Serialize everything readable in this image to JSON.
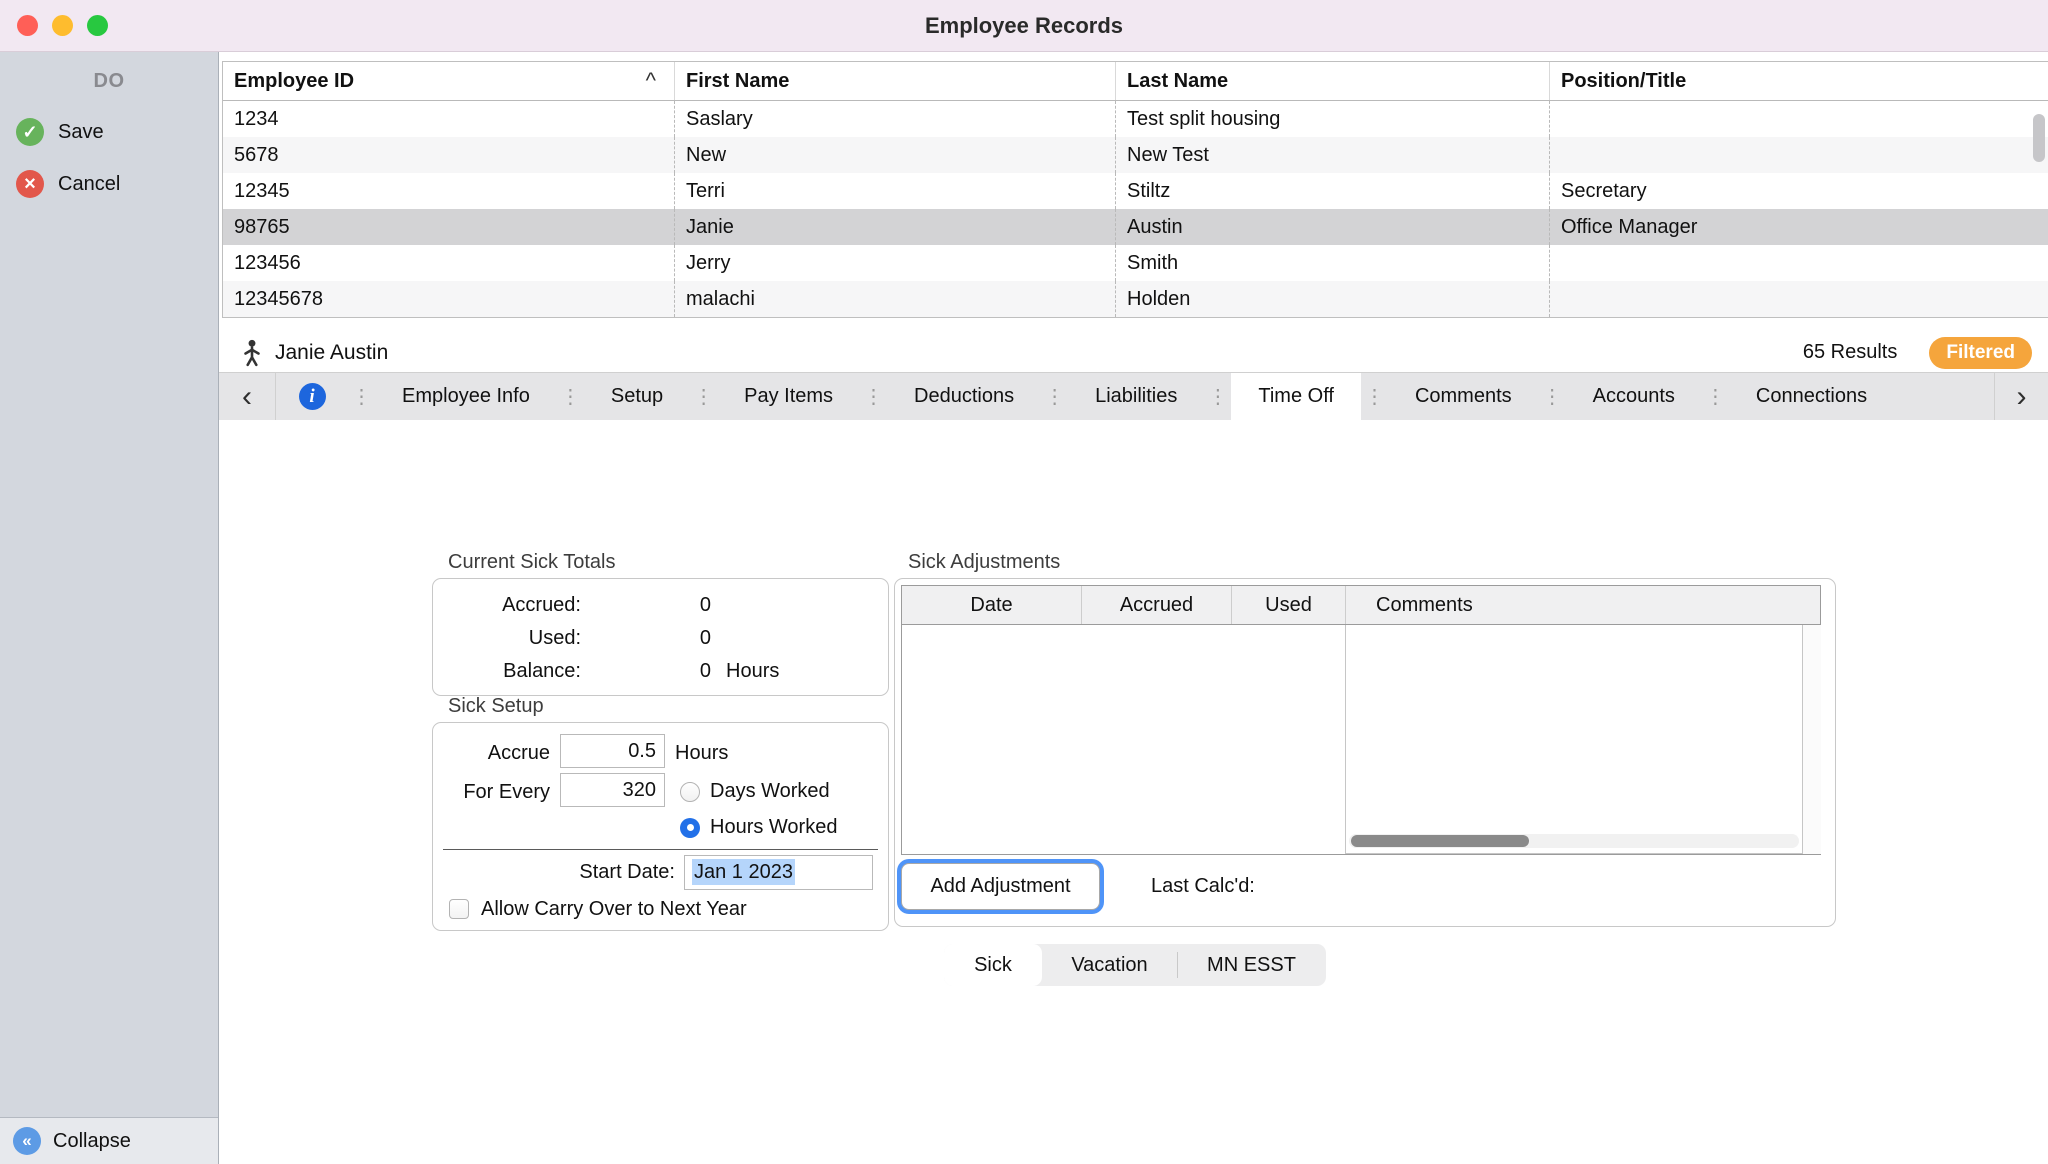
{
  "window": {
    "title": "Employee Records"
  },
  "sidebar": {
    "header": "DO",
    "save_label": "Save",
    "cancel_label": "Cancel",
    "collapse_label": "Collapse"
  },
  "icons": {
    "save_check": "✓",
    "cancel_x": "×",
    "collapse_chevrons": "«",
    "back_chevron": "‹",
    "forward_chevron": "›",
    "tab_separator": "⋮",
    "sort_ascending": "^",
    "info": "i"
  },
  "employee_table": {
    "columns": [
      "Employee ID",
      "First Name",
      "Last Name",
      "Position/Title"
    ],
    "rows": [
      {
        "id": "1234",
        "first_name": "Saslary",
        "last_name": "Test split housing",
        "position": ""
      },
      {
        "id": "5678",
        "first_name": "New",
        "last_name": "New Test",
        "position": ""
      },
      {
        "id": "12345",
        "first_name": "Terri",
        "last_name": "Stiltz",
        "position": "Secretary"
      },
      {
        "id": "98765",
        "first_name": "Janie",
        "last_name": "Austin",
        "position": "Office Manager"
      },
      {
        "id": "123456",
        "first_name": "Jerry",
        "last_name": "Smith",
        "position": ""
      },
      {
        "id": "12345678",
        "first_name": "malachi",
        "last_name": "Holden",
        "position": ""
      }
    ],
    "selected_employee_id": "98765"
  },
  "record_bar": {
    "name": "Janie Austin",
    "results": "65 Results",
    "filter_badge": "Filtered"
  },
  "tab_bar": {
    "tabs": [
      "Employee Info",
      "Setup",
      "Pay Items",
      "Deductions",
      "Liabilities",
      "Time Off",
      "Comments",
      "Accounts",
      "Connections"
    ],
    "active_tab": "Time Off"
  },
  "current_sick_totals": {
    "title": "Current Sick Totals",
    "rows": [
      {
        "label": "Accrued:",
        "value": "0",
        "unit": ""
      },
      {
        "label": "Used:",
        "value": "0",
        "unit": ""
      },
      {
        "label": "Balance:",
        "value": "0",
        "unit": "Hours"
      }
    ]
  },
  "sick_setup": {
    "title": "Sick Setup",
    "accrue_label": "Accrue",
    "accrue_value": "0.5",
    "accrue_unit": "Hours",
    "for_every_label": "For Every",
    "for_every_value": "320",
    "days_worked_label": "Days Worked",
    "hours_worked_label": "Hours Worked",
    "selected_accrual_basis": "Hours Worked",
    "start_date_label": "Start Date:",
    "start_date_value": "Jan 1 2023",
    "carry_over_label": "Allow Carry Over to Next Year",
    "carry_over_checked": false
  },
  "sick_adjustments": {
    "title": "Sick Adjustments",
    "columns": [
      "Date",
      "Accrued",
      "Used",
      "Comments"
    ],
    "add_button_label": "Add Adjustment",
    "last_calcd_label": "Last Calc'd:"
  },
  "bottom_tabs": {
    "items": [
      "Sick",
      "Vacation",
      "MN ESST"
    ],
    "active": "Sick"
  },
  "colors": {
    "filter_badge": "#F5A53C",
    "accent_blue": "#2270E8",
    "info_icon_blue": "#1D66DD"
  }
}
